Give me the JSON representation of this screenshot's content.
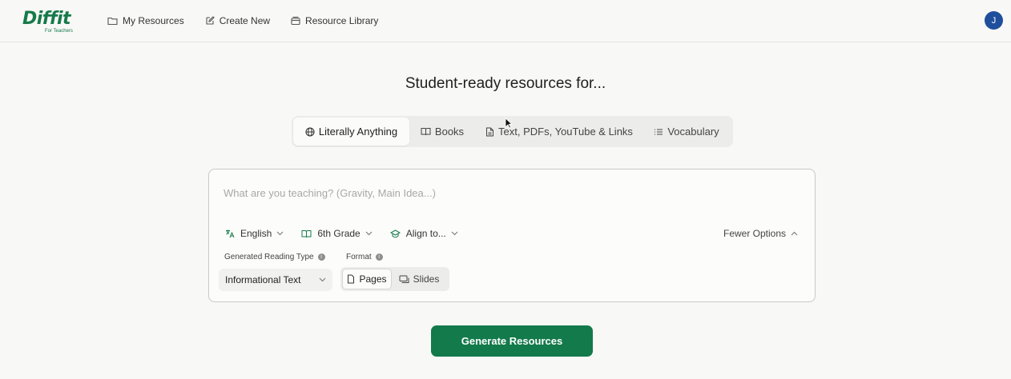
{
  "header": {
    "logo_text": "Diffit",
    "logo_subtext": "For Teachers",
    "nav": [
      {
        "label": "My Resources",
        "icon": "folder-icon"
      },
      {
        "label": "Create New",
        "icon": "edit-icon"
      },
      {
        "label": "Resource Library",
        "icon": "library-icon"
      }
    ],
    "avatar_initial": "J"
  },
  "headline": "Student-ready resources for...",
  "tabs": [
    {
      "label": "Literally Anything",
      "icon": "globe-icon",
      "active": true
    },
    {
      "label": "Books",
      "icon": "book-icon",
      "active": false
    },
    {
      "label": "Text, PDFs, YouTube & Links",
      "icon": "document-icon",
      "active": false
    },
    {
      "label": "Vocabulary",
      "icon": "list-icon",
      "active": false
    }
  ],
  "form": {
    "topic_placeholder": "What are you teaching? (Gravity, Main Idea...)",
    "topic_value": "",
    "language": "English",
    "grade": "6th Grade",
    "align": "Align to...",
    "fewer_options": "Fewer Options",
    "reading_type_label": "Generated Reading Type",
    "reading_type_value": "Informational Text",
    "format_label": "Format",
    "format_options": [
      "Pages",
      "Slides"
    ],
    "format_selected": "Pages"
  },
  "generate_label": "Generate Resources",
  "colors": {
    "brand_green": "#137a4b",
    "avatar_blue": "#1f4f9c"
  }
}
